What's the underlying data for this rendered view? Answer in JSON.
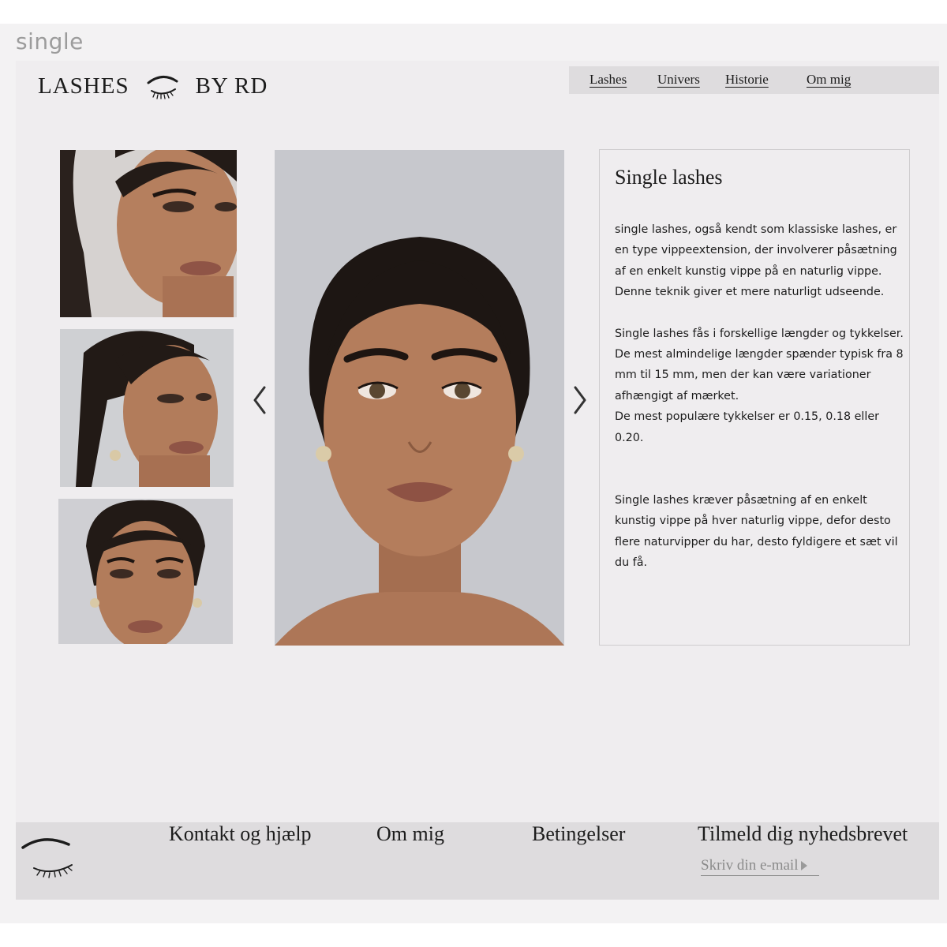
{
  "frame": {
    "label": "single"
  },
  "header": {
    "logo_left": "LASHES",
    "logo_right": "BY RD",
    "logo_icon": "eye-lash-icon",
    "nav": [
      {
        "label": "Lashes"
      },
      {
        "label": "Univers"
      },
      {
        "label": "Historie"
      },
      {
        "label": "Om mig"
      }
    ]
  },
  "gallery": {
    "thumbnails": [
      {
        "description_icon": "photo-profile-three-quarter"
      },
      {
        "description_icon": "photo-profile-side"
      },
      {
        "description_icon": "photo-front"
      }
    ],
    "prev_icon": "chevron-left-icon",
    "next_icon": "chevron-right-icon"
  },
  "info": {
    "title": "Single lashes",
    "paragraphs": [
      [
        "single lashes, også kendt som klassiske lashes, er",
        "en type vippeextension, der involverer påsætning",
        "af en enkelt kunstig vippe på en naturlig vippe.",
        "Denne teknik giver et mere naturligt udseende."
      ],
      [
        "Single lashes fås i forskellige længder og tykkelser.",
        "De mest almindelige længder spænder typisk fra 8",
        "mm til 15 mm, men der kan være variationer",
        "afhængigt af mærket.",
        "De mest populære tykkelser er 0.15, 0.18 eller 0.20."
      ],
      [
        "Single lashes kræver påsætning af en enkelt",
        "kunstig vippe på hver naturlig vippe, defor desto",
        "flere naturvipper du har, desto fyldigere et sæt vil",
        "du få."
      ]
    ]
  },
  "footer": {
    "links": [
      {
        "label": "Kontakt og hjælp"
      },
      {
        "label": "Om mig"
      },
      {
        "label": "Betingelser"
      },
      {
        "label": "Tilmeld dig nyhedsbrevet"
      }
    ],
    "email_placeholder": "Skriv din e-mail",
    "colors": {
      "page_bg": "#efedef",
      "nav_bg": "#dedcde",
      "footer_bg": "#dedcde",
      "text": "#1c1c1c"
    }
  }
}
